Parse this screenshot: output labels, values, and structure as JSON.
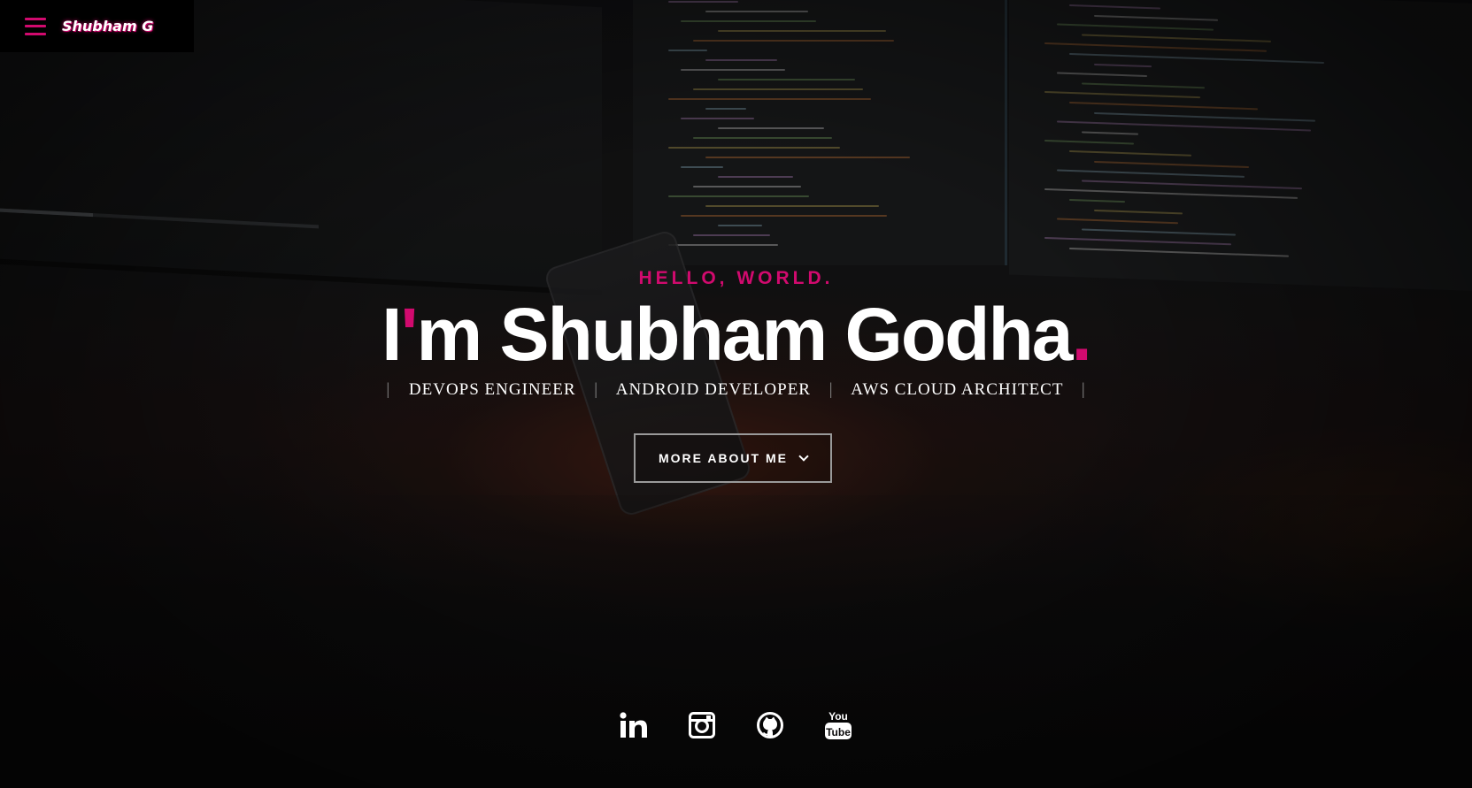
{
  "header": {
    "brand": "Shubham G",
    "menu_icon": "hamburger-menu-icon",
    "accent_color": "#d10a6e"
  },
  "hero": {
    "greeting": "HELLO, WORLD.",
    "headline_prefix": "I",
    "headline_apostrophe": "'",
    "headline_main": "m Shubham Godha",
    "headline_dot": ".",
    "roles": [
      "DEVOPS ENGINEER",
      "ANDROID DEVELOPER",
      "AWS CLOUD ARCHITECT"
    ],
    "separator": "|",
    "cta_label": "MORE ABOUT ME",
    "cta_icon": "chevron-down-icon"
  },
  "socials": [
    {
      "name": "linkedin",
      "icon": "linkedin-icon"
    },
    {
      "name": "instagram",
      "icon": "instagram-icon"
    },
    {
      "name": "github",
      "icon": "github-icon"
    },
    {
      "name": "youtube",
      "icon": "youtube-icon",
      "text_top": "You",
      "text_bottom": "Tube"
    }
  ],
  "colors": {
    "accent": "#d10a6e",
    "text": "#ffffff",
    "background": "#0c0b0c"
  }
}
